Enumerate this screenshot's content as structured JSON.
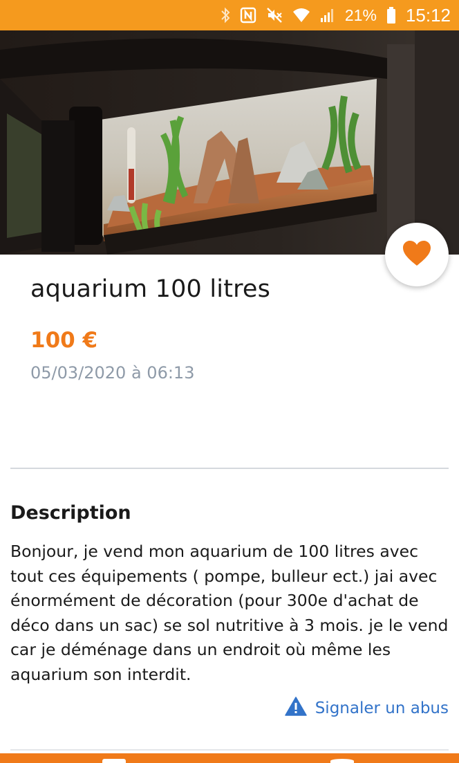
{
  "status_bar": {
    "battery": "21%",
    "time": "15:12",
    "icons": [
      "bluetooth-icon",
      "nfc-icon",
      "mute-icon",
      "wifi-icon",
      "signal-icon",
      "battery-icon"
    ]
  },
  "listing": {
    "title": "aquarium 100 litres",
    "price": "100 €",
    "date": "05/03/2020 à 06:13",
    "favorite_icon": "heart-icon"
  },
  "description": {
    "heading": "Description",
    "body": "Bonjour, je vend mon aquarium de 100 litres avec tout ces équipements ( pompe, bulleur ect.) jai avec énormément de décoration (pour 300e d'achat de déco dans un sac) se sol nutritive à 3 mois. je le vend car je déménage dans un endroit où même les aquarium son interdit."
  },
  "report": {
    "label": "Signaler un abus",
    "icon": "warning-icon"
  },
  "colors": {
    "status_bar": "#f59a1e",
    "accent": "#f07a19",
    "link": "#3273c9",
    "muted_text": "#8e9aa8"
  }
}
